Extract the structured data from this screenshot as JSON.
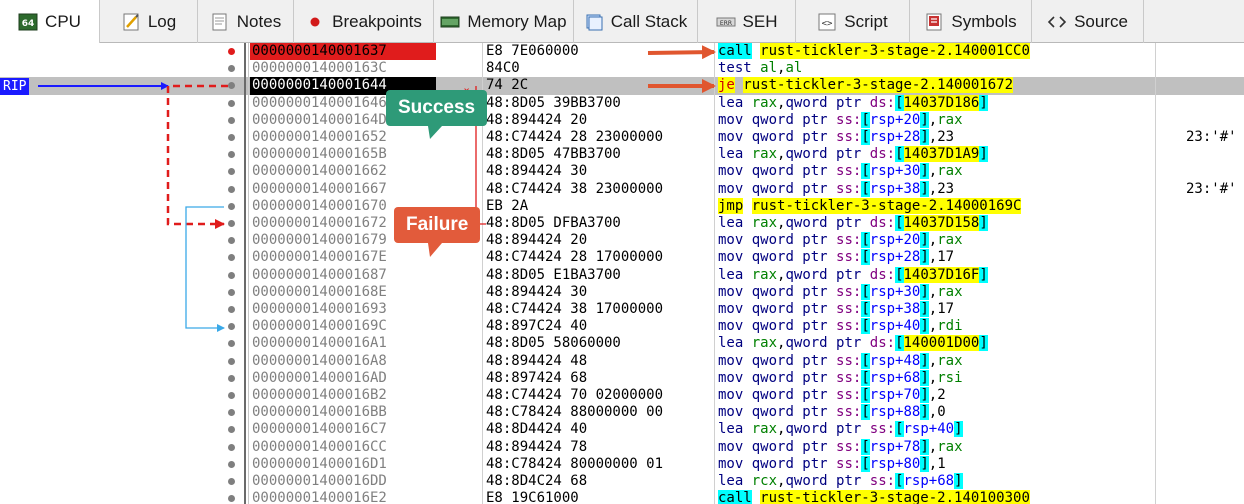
{
  "tabs": [
    {
      "key": "cpu",
      "label": "CPU",
      "icon": "cpu-icon",
      "active": true
    },
    {
      "key": "log",
      "label": "Log",
      "icon": "log-icon",
      "active": false
    },
    {
      "key": "notes",
      "label": "Notes",
      "icon": "notes-icon",
      "active": false
    },
    {
      "key": "breakpoints",
      "label": "Breakpoints",
      "icon": "breakpoint-dot-icon",
      "active": false
    },
    {
      "key": "memory-map",
      "label": "Memory Map",
      "icon": "memory-map-icon",
      "active": false
    },
    {
      "key": "call-stack",
      "label": "Call Stack",
      "icon": "call-stack-icon",
      "active": false
    },
    {
      "key": "seh",
      "label": "SEH",
      "icon": "seh-icon",
      "active": false
    },
    {
      "key": "script",
      "label": "Script",
      "icon": "script-icon",
      "active": false
    },
    {
      "key": "symbols",
      "label": "Symbols",
      "icon": "symbols-icon",
      "active": false
    },
    {
      "key": "source",
      "label": "Source",
      "icon": "source-icon",
      "active": false
    }
  ],
  "rip_label": "RIP",
  "callouts": {
    "success": "Success",
    "failure": "Failure"
  },
  "colors": {
    "breakpoint": "#e01c1c",
    "rip": "#1a1aff",
    "success": "#2e9a78",
    "failure": "#e25b3b",
    "highlight": "#ffff00",
    "cyan": "#00ffff"
  },
  "rows": [
    {
      "addr": "0000000140001637",
      "bytes": "E8 7E060000",
      "asm": "call rust-tickler-3-stage-2.140001CC0",
      "comment": "",
      "breakpoint": true,
      "rip": false
    },
    {
      "addr": "000000014000163C",
      "bytes": "84C0",
      "asm": "test al,al",
      "comment": "",
      "breakpoint": false,
      "rip": false
    },
    {
      "addr": "0000000140001644",
      "bytes": "74 2C",
      "asm": "je rust-tickler-3-stage-2.140001672",
      "comment": "",
      "breakpoint": false,
      "rip": true
    },
    {
      "addr": "0000000140001646",
      "bytes": "48:8D05 39BB3700",
      "asm": "lea rax,qword ptr ds:[14037D186]",
      "comment": "",
      "breakpoint": false,
      "rip": false
    },
    {
      "addr": "000000014000164D",
      "bytes": "48:894424 20",
      "asm": "mov qword ptr ss:[rsp+20],rax",
      "comment": "",
      "breakpoint": false,
      "rip": false
    },
    {
      "addr": "0000000140001652",
      "bytes": "48:C74424 28 23000000",
      "asm": "mov qword ptr ss:[rsp+28],23",
      "comment": "23:'#'",
      "breakpoint": false,
      "rip": false
    },
    {
      "addr": "000000014000165B",
      "bytes": "48:8D05 47BB3700",
      "asm": "lea rax,qword ptr ds:[14037D1A9]",
      "comment": "",
      "breakpoint": false,
      "rip": false
    },
    {
      "addr": "0000000140001662",
      "bytes": "48:894424 30",
      "asm": "mov qword ptr ss:[rsp+30],rax",
      "comment": "",
      "breakpoint": false,
      "rip": false
    },
    {
      "addr": "0000000140001667",
      "bytes": "48:C74424 38 23000000",
      "asm": "mov qword ptr ss:[rsp+38],23",
      "comment": "23:'#'",
      "breakpoint": false,
      "rip": false
    },
    {
      "addr": "0000000140001670",
      "bytes": "EB 2A",
      "asm": "jmp rust-tickler-3-stage-2.14000169C",
      "comment": "",
      "breakpoint": false,
      "rip": false
    },
    {
      "addr": "0000000140001672",
      "bytes": "48:8D05 DFBA3700",
      "asm": "lea rax,qword ptr ds:[14037D158]",
      "comment": "",
      "breakpoint": false,
      "rip": false
    },
    {
      "addr": "0000000140001679",
      "bytes": "48:894424 20",
      "asm": "mov qword ptr ss:[rsp+20],rax",
      "comment": "",
      "breakpoint": false,
      "rip": false
    },
    {
      "addr": "000000014000167E",
      "bytes": "48:C74424 28 17000000",
      "asm": "mov qword ptr ss:[rsp+28],17",
      "comment": "",
      "breakpoint": false,
      "rip": false
    },
    {
      "addr": "0000000140001687",
      "bytes": "48:8D05 E1BA3700",
      "asm": "lea rax,qword ptr ds:[14037D16F]",
      "comment": "",
      "breakpoint": false,
      "rip": false
    },
    {
      "addr": "000000014000168E",
      "bytes": "48:894424 30",
      "asm": "mov qword ptr ss:[rsp+30],rax",
      "comment": "",
      "breakpoint": false,
      "rip": false
    },
    {
      "addr": "0000000140001693",
      "bytes": "48:C74424 38 17000000",
      "asm": "mov qword ptr ss:[rsp+38],17",
      "comment": "",
      "breakpoint": false,
      "rip": false
    },
    {
      "addr": "000000014000169C",
      "bytes": "48:897C24 40",
      "asm": "mov qword ptr ss:[rsp+40],rdi",
      "comment": "",
      "breakpoint": false,
      "rip": false
    },
    {
      "addr": "00000001400016A1",
      "bytes": "48:8D05 58060000",
      "asm": "lea rax,qword ptr ds:[140001D00]",
      "comment": "",
      "breakpoint": false,
      "rip": false
    },
    {
      "addr": "00000001400016A8",
      "bytes": "48:894424 48",
      "asm": "mov qword ptr ss:[rsp+48],rax",
      "comment": "",
      "breakpoint": false,
      "rip": false
    },
    {
      "addr": "00000001400016AD",
      "bytes": "48:897424 68",
      "asm": "mov qword ptr ss:[rsp+68],rsi",
      "comment": "",
      "breakpoint": false,
      "rip": false
    },
    {
      "addr": "00000001400016B2",
      "bytes": "48:C74424 70 02000000",
      "asm": "mov qword ptr ss:[rsp+70],2",
      "comment": "",
      "breakpoint": false,
      "rip": false
    },
    {
      "addr": "00000001400016BB",
      "bytes": "48:C78424 88000000 00",
      "asm": "mov qword ptr ss:[rsp+88],0",
      "comment": "",
      "breakpoint": false,
      "rip": false
    },
    {
      "addr": "00000001400016C7",
      "bytes": "48:8D4424 40",
      "asm": "lea rax,qword ptr ss:[rsp+40]",
      "comment": "",
      "breakpoint": false,
      "rip": false
    },
    {
      "addr": "00000001400016CC",
      "bytes": "48:894424 78",
      "asm": "mov qword ptr ss:[rsp+78],rax",
      "comment": "",
      "breakpoint": false,
      "rip": false
    },
    {
      "addr": "00000001400016D1",
      "bytes": "48:C78424 80000000 01",
      "asm": "mov qword ptr ss:[rsp+80],1",
      "comment": "",
      "breakpoint": false,
      "rip": false
    },
    {
      "addr": "00000001400016DD",
      "bytes": "48:8D4C24 68",
      "asm": "lea rcx,qword ptr ss:[rsp+68]",
      "comment": "",
      "breakpoint": false,
      "rip": false
    },
    {
      "addr": "00000001400016E2",
      "bytes": "E8 19C61000",
      "asm": "call rust-tickler-3-stage-2.140100300",
      "comment": "",
      "breakpoint": false,
      "rip": false
    }
  ]
}
